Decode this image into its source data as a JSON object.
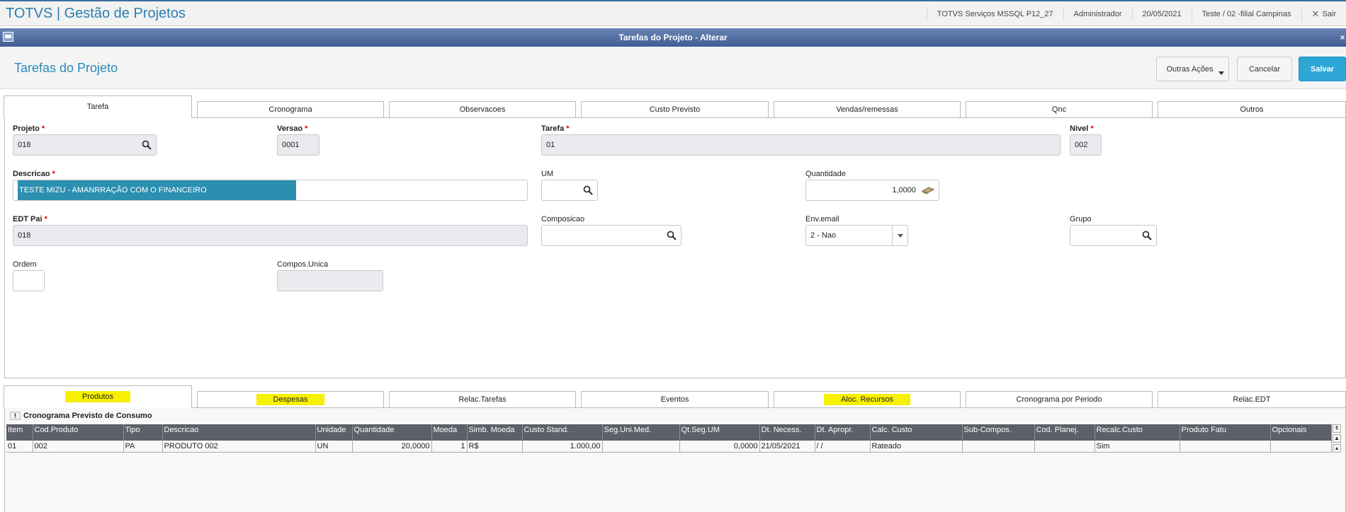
{
  "topbar": {
    "app_title": "TOTVS | Gestão de Projetos",
    "environment": "TOTVS Serviços MSSQL P12_27",
    "user": "Administrador",
    "date": "20/05/2021",
    "branch": "Teste / 02 -filial Campinas",
    "exit_label": "Sair"
  },
  "window": {
    "title": "Tarefas do Projeto - Alterar"
  },
  "header": {
    "page_title": "Tarefas do Projeto",
    "other_actions_label": "Outras Ações",
    "cancel_label": "Cancelar",
    "save_label": "Salvar"
  },
  "top_tabs": [
    "Tarefa",
    "Cronograma",
    "Observacoes",
    "Custo Previsto",
    "Vendas/remessas",
    "Qnc",
    "Outros"
  ],
  "form": {
    "projeto": {
      "label": "Projeto",
      "value": "018"
    },
    "versao": {
      "label": "Versao",
      "value": "0001"
    },
    "tarefa": {
      "label": "Tarefa",
      "value": "01"
    },
    "nivel": {
      "label": "Nivel",
      "value": "002"
    },
    "descricao": {
      "label": "Descricao",
      "value": "TESTE MIZU - AMANRRAÇÃO COM O FINANCEIRO"
    },
    "um": {
      "label": "UM",
      "value": ""
    },
    "quantidade": {
      "label": "Quantidade",
      "value": "1,0000"
    },
    "edt_pai": {
      "label": "EDT Pai",
      "value": "018"
    },
    "composicao": {
      "label": "Composicao",
      "value": ""
    },
    "env_email": {
      "label": "Env.email",
      "value": "2 - Nao"
    },
    "grupo": {
      "label": "Grupo",
      "value": ""
    },
    "ordem": {
      "label": "Ordem",
      "value": ""
    },
    "compos_unica": {
      "label": "Compos.Unica",
      "value": ""
    }
  },
  "bottom_tabs": [
    "Produtos",
    "Despesas",
    "Relac.Tarefas",
    "Eventos",
    "Aloc. Recursos",
    "Cronograma por Periodo",
    "Relac.EDT"
  ],
  "grid": {
    "title": "Cronograma Previsto de Consumo",
    "columns": [
      "Item",
      "Cod.Produto",
      "Tipo",
      "Descricao",
      "Unidade",
      "Quantidade",
      "Moeda",
      "Simb. Moeda",
      "Custo Stand.",
      "Seg.Uni.Med.",
      "Qt.Seg.UM",
      "Dt. Necess.",
      "Dt. Apropr.",
      "Calc. Custo",
      "Sub-Compos.",
      "Cod. Planej.",
      "Recalc.Custo",
      "Produto Fatu",
      "Opcionais"
    ],
    "rows": [
      [
        "01",
        "002",
        "PA",
        "PRODUTO 002",
        "UN",
        "20,0000",
        "1",
        "R$",
        "1.000,00",
        "",
        "0,0000",
        "21/05/2021",
        " /  /",
        "Rateado",
        "",
        "",
        "Sim",
        "",
        ""
      ]
    ]
  },
  "colors": {
    "accent": "#2a8ab8",
    "save": "#2ea6d6",
    "window_bar": "#4f6ca0",
    "highlight": "#f7f000"
  }
}
